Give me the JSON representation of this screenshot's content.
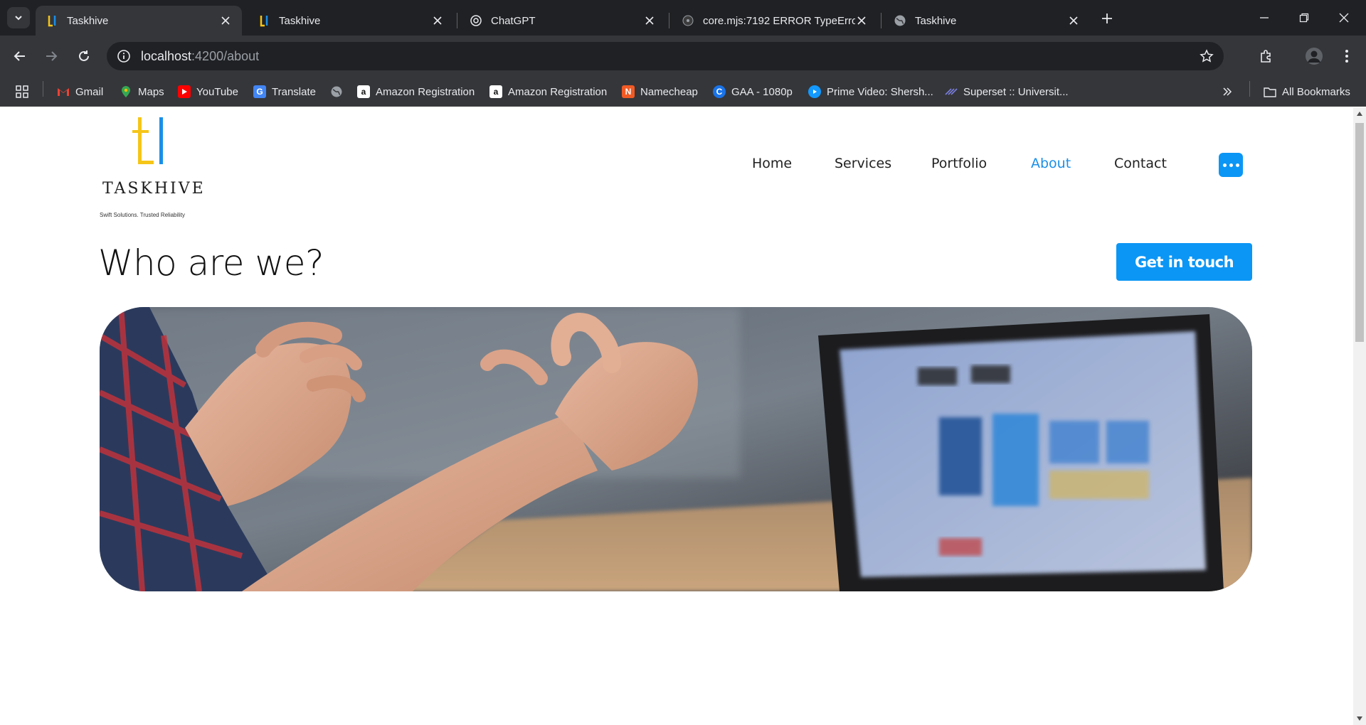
{
  "browser": {
    "tabs": [
      {
        "title": "Taskhive",
        "favicon": "taskhive-logo",
        "active": true
      },
      {
        "title": "Taskhive",
        "favicon": "taskhive-logo",
        "active": false
      },
      {
        "title": "ChatGPT",
        "favicon": "chatgpt-logo",
        "active": false
      },
      {
        "title": "core.mjs:7192 ERROR TypeError",
        "favicon": "angular-logo",
        "active": false
      },
      {
        "title": "Taskhive",
        "favicon": "globe-icon",
        "active": false
      }
    ],
    "url_host": "localhost",
    "url_path": ":4200/about",
    "bookmarks": [
      {
        "label": "Gmail",
        "icon": "gmail-icon",
        "color": "#ea4335"
      },
      {
        "label": "Maps",
        "icon": "maps-icon",
        "color": "#34a853"
      },
      {
        "label": "YouTube",
        "icon": "youtube-icon",
        "color": "#ff0000"
      },
      {
        "label": "Translate",
        "icon": "translate-icon",
        "color": "#4285f4"
      },
      {
        "label": "",
        "icon": "globe-icon",
        "color": "#9aa0a6"
      },
      {
        "label": "Amazon Registration",
        "icon": "amazon-icon",
        "color": "#ffffff"
      },
      {
        "label": "Amazon Registration",
        "icon": "amazon-icon",
        "color": "#ffffff"
      },
      {
        "label": "Namecheap",
        "icon": "namecheap-icon",
        "color": "#f15a24"
      },
      {
        "label": "GAA - 1080p",
        "icon": "gaa-icon",
        "color": "#1a73e8"
      },
      {
        "label": "Prime Video: Shersh...",
        "icon": "prime-video-icon",
        "color": "#1399ff"
      },
      {
        "label": "Superset :: Universit...",
        "icon": "superset-icon",
        "color": "#5b5fc7"
      }
    ],
    "all_bookmarks_label": "All Bookmarks"
  },
  "site": {
    "brand": {
      "name": "TASKHIVE",
      "tagline": "Swift Solutions. Trusted Reliability",
      "colors": {
        "yellow": "#f5c518",
        "blue": "#1a8fe8"
      }
    },
    "nav": [
      {
        "label": "Home",
        "active": false
      },
      {
        "label": "Services",
        "active": false
      },
      {
        "label": "Portfolio",
        "active": false
      },
      {
        "label": "About",
        "active": true
      },
      {
        "label": "Contact",
        "active": false
      }
    ],
    "accent_color": "#0b96f5",
    "heading": "Who are we?",
    "cta_label": "Get in touch",
    "hero_image": "photo-hands-gesturing-laptop"
  }
}
